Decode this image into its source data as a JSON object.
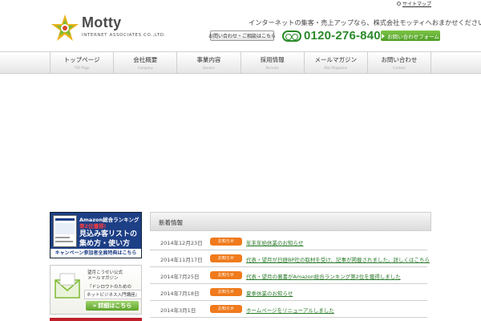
{
  "utility": {
    "sitemap_label": "サイトマップ"
  },
  "header": {
    "logo_name": "Motty",
    "logo_sub": "INTERNET ASSOCIATES CO.,LTD.",
    "tagline": "インターネットの集客・売上アップなら、株式会社モッティへおまかせください。",
    "contact_button": "お問い合わせ・ご相談はこちら",
    "phone": "0120-276-840",
    "form_button": "お問い合わせフォーム"
  },
  "nav": {
    "items": [
      {
        "label": "トップページ",
        "sub": "TOP Page"
      },
      {
        "label": "会社概要",
        "sub": "Company"
      },
      {
        "label": "事業内容",
        "sub": "Service"
      },
      {
        "label": "採用情報",
        "sub": "Recruits"
      },
      {
        "label": "メールマガジン",
        "sub": "Mail Magazine"
      },
      {
        "label": "お問い合わせ",
        "sub": "Contact"
      }
    ]
  },
  "sidebar": {
    "banner_amazon": {
      "line1": "Amazon総合ランキング",
      "line2": "第2位獲得!",
      "line3": "見込み客リストの",
      "line4": "集め方・使い方",
      "footer": "キャンペーン参加者全員特典はこちら"
    },
    "banner_mail": {
      "line1": "望月こうせい公式",
      "line2": "メールマガジン",
      "line3": "『ドシロウトのための",
      "line4": "ネットビジネス入門講座』",
      "button": "詳細はこちら"
    }
  },
  "news": {
    "heading": "新着情報",
    "items": [
      {
        "date": "2014年12月23日",
        "badge": "お知らせ",
        "title": "年末年始休業のお知らせ"
      },
      {
        "date": "2014年11月17日",
        "badge": "お知らせ",
        "title": "代表・望月が日経BP社の取材を受け、記事が掲載されました。詳しくはこちら"
      },
      {
        "date": "2014年7月25日",
        "badge": "お知らせ",
        "title": "代表・望月の著書がAmazon総合ランキング第2位を獲得しました"
      },
      {
        "date": "2014年7月18日",
        "badge": "お知らせ",
        "title": "夏季休業のお知らせ"
      },
      {
        "date": "2014年3月1日",
        "badge": "お知らせ",
        "title": "ホームページをリニューアルしました"
      }
    ]
  },
  "colors": {
    "accent_green": "#2a8a2a",
    "badge_orange": "#f07a1c",
    "banner_navy": "#1d3f86"
  }
}
